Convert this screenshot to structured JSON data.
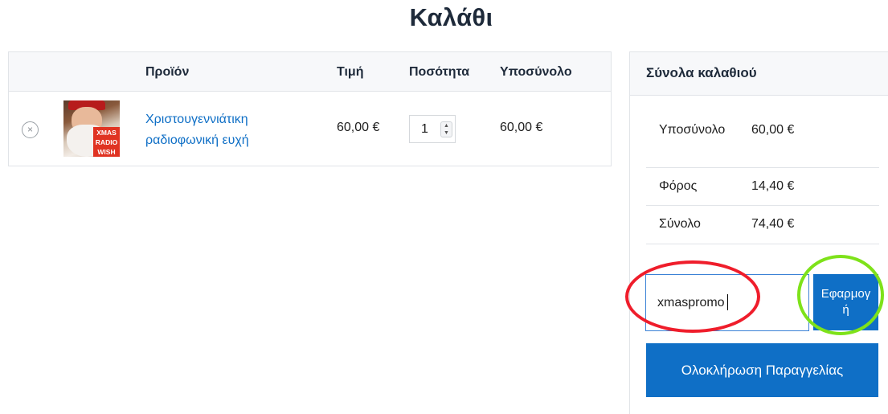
{
  "page": {
    "title": "Καλάθι"
  },
  "cart": {
    "headers": {
      "product": "Προϊόν",
      "price": "Τιμή",
      "quantity": "Ποσότητα",
      "subtotal": "Υποσύνολο"
    },
    "items": [
      {
        "remove_icon": "×",
        "thumbnail_text": "XMAS RADIO WISH",
        "name": "Χριστουγεννιάτικη ραδιοφωνική ευχή",
        "price": "60,00 €",
        "quantity": "1",
        "subtotal": "60,00 €"
      }
    ]
  },
  "totals": {
    "title": "Σύνολα καλαθιού",
    "subtotal_label": "Υποσύνολο",
    "subtotal_value": "60,00 €",
    "tax_label": "Φόρος",
    "tax_value": "14,40 €",
    "total_label": "Σύνολο",
    "total_value": "74,40 €"
  },
  "coupon": {
    "value": "xmaspromo",
    "apply_label": "Εφαρμογή"
  },
  "checkout": {
    "label": "Ολοκλήρωση Παραγγελίας"
  },
  "annotations": {
    "red_ring_color": "#ef1d2b",
    "green_ring_color": "#7ee21a"
  },
  "colors": {
    "accent": "#0f6fc6",
    "heading": "#1e2a3a"
  }
}
